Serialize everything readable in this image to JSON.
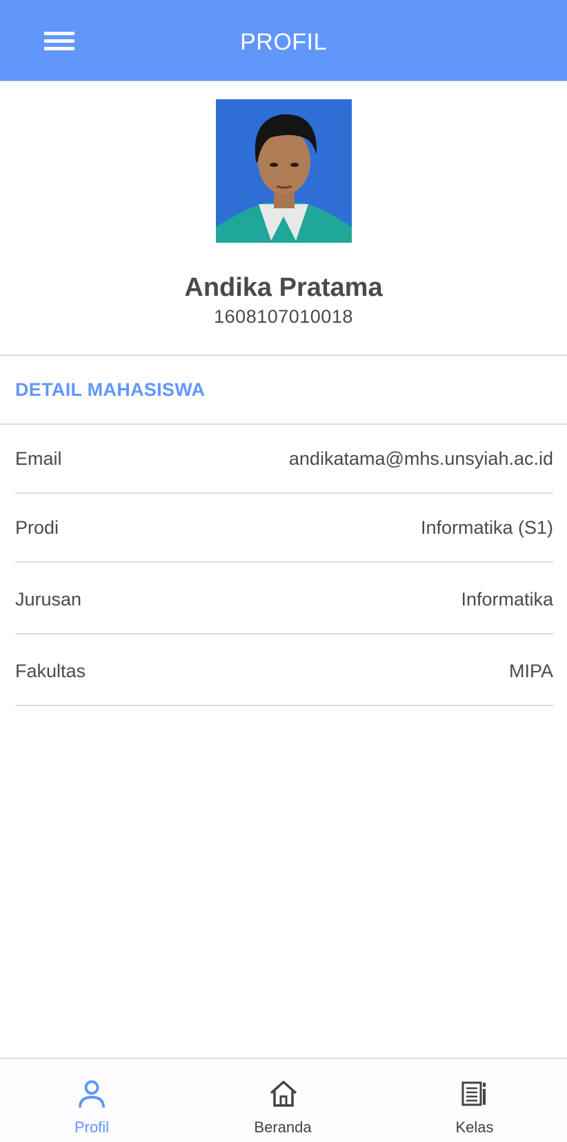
{
  "appbar": {
    "title": "PROFIL",
    "menu_icon": "hamburger-menu-icon",
    "color": "#6197fa"
  },
  "profile": {
    "photo_alt": "Andika Pratama",
    "name": "Andika Pratama",
    "nim": "1608107010018"
  },
  "section": {
    "title": "DETAIL MAHASISWA",
    "accent": "#6197fa"
  },
  "details": [
    {
      "label": "Email",
      "value": "andikatama@mhs.unsyiah.ac.id"
    },
    {
      "label": "Prodi",
      "value": "Informatika (S1)"
    },
    {
      "label": "Jurusan",
      "value": "Informatika"
    },
    {
      "label": "Fakultas",
      "value": "MIPA"
    }
  ],
  "bottom_nav": [
    {
      "label": "Profil",
      "icon": "person-icon",
      "active": true
    },
    {
      "label": "Beranda",
      "icon": "home-icon",
      "active": false
    },
    {
      "label": "Kelas",
      "icon": "document-list-icon",
      "active": false
    }
  ]
}
